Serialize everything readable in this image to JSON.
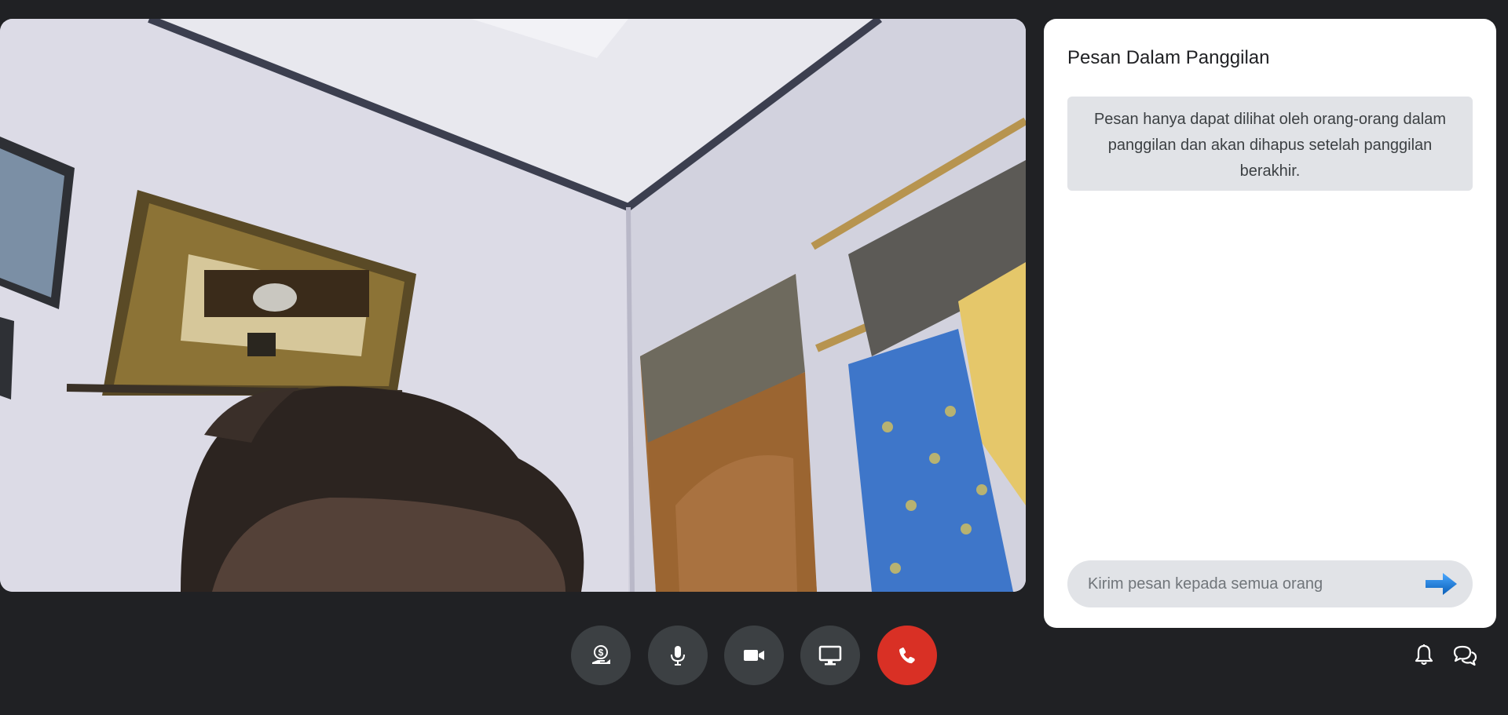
{
  "chat": {
    "title": "Pesan Dalam Panggilan",
    "notice": "Pesan hanya dapat dilihat oleh orang-orang dalam panggilan dan akan dihapus setelah panggilan berakhir.",
    "input_placeholder": "Kirim pesan kepada semua orang",
    "send_icon": "arrow-right-icon"
  },
  "controls": [
    {
      "name": "money-control-button",
      "icon": "dollar-hand-icon"
    },
    {
      "name": "microphone-button",
      "icon": "microphone-icon"
    },
    {
      "name": "camera-button",
      "icon": "video-camera-icon"
    },
    {
      "name": "share-screen-button",
      "icon": "desktop-icon"
    },
    {
      "name": "end-call-button",
      "icon": "phone-icon",
      "color": "#d93025"
    }
  ],
  "top_right": [
    {
      "name": "notifications-button",
      "icon": "bell-icon"
    },
    {
      "name": "chat-toggle-button",
      "icon": "chat-bubbles-icon"
    }
  ],
  "colors": {
    "background": "#202124",
    "panel": "#ffffff",
    "control": "#3c4043",
    "end_call": "#d93025",
    "notice_bg": "#e1e3e7"
  }
}
